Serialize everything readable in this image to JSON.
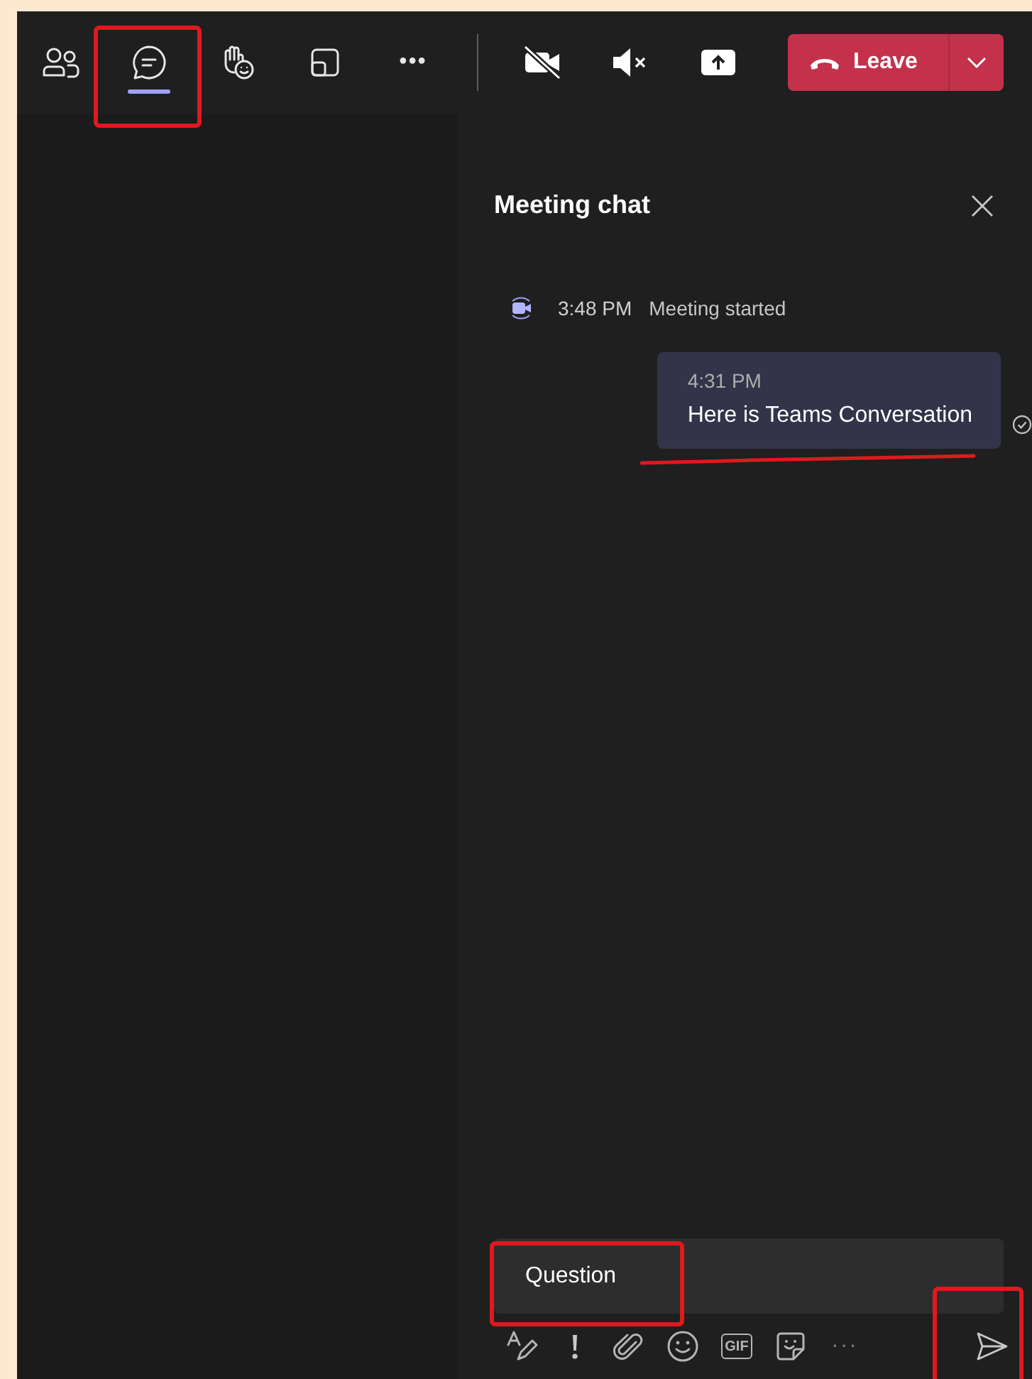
{
  "toolbar": {
    "buttons": [
      {
        "kind": "people",
        "selected": false
      },
      {
        "kind": "chat",
        "selected": true
      },
      {
        "kind": "react",
        "selected": false
      },
      {
        "kind": "rooms",
        "selected": false
      },
      {
        "kind": "more",
        "label": "•••",
        "selected": false
      }
    ],
    "media": [
      {
        "kind": "camera-off"
      },
      {
        "kind": "speaker-muted"
      },
      {
        "kind": "share"
      }
    ],
    "leave": {
      "label": "Leave"
    }
  },
  "chat": {
    "title": "Meeting chat",
    "events": [
      {
        "time": "3:48 PM",
        "text": "Meeting started"
      }
    ],
    "messages": [
      {
        "time": "4:31 PM",
        "text": "Here is Teams Conversation"
      }
    ],
    "composer": {
      "value": "Question",
      "tools": [
        {
          "kind": "format"
        },
        {
          "kind": "important"
        },
        {
          "kind": "attach"
        },
        {
          "kind": "emoji"
        },
        {
          "kind": "gif",
          "label": "GIF"
        },
        {
          "kind": "sticker"
        },
        {
          "kind": "more",
          "label": "···"
        }
      ]
    }
  }
}
